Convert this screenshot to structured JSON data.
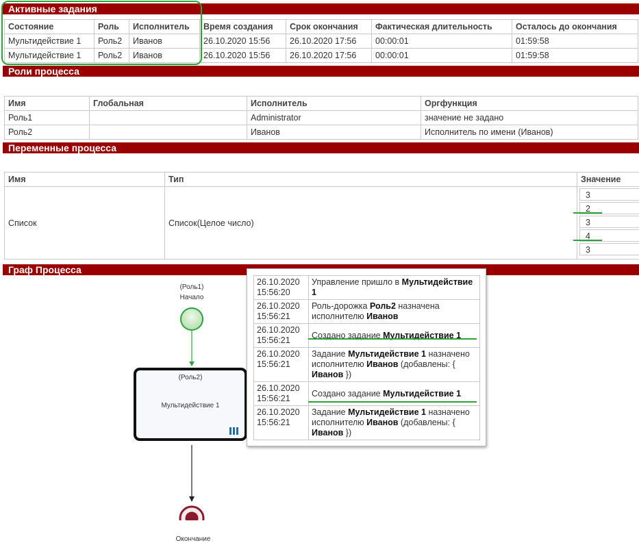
{
  "active_tasks": {
    "title": "Активные задания",
    "columns": [
      "Состояние",
      "Роль",
      "Исполнитель",
      "Время создания",
      "Срок окончания",
      "Фактическая длительность",
      "Осталось до окончания"
    ],
    "rows": [
      [
        "Мультидействие 1",
        "Роль2",
        "Иванов",
        "26.10.2020 15:56",
        "26.10.2020 17:56",
        "00:00:01",
        "01:59:58"
      ],
      [
        "Мультидействие 1",
        "Роль2",
        "Иванов",
        "26.10.2020 15:56",
        "26.10.2020 17:56",
        "00:00:01",
        "01:59:58"
      ]
    ]
  },
  "roles": {
    "title": "Роли процесса",
    "columns": [
      "Имя",
      "Глобальная",
      "Исполнитель",
      "Оргфункция"
    ],
    "rows": [
      [
        "Роль1",
        "",
        "Administrator",
        "значение не задано"
      ],
      [
        "Роль2",
        "",
        "Иванов",
        "Исполнитель по имени (Иванов)"
      ]
    ]
  },
  "variables": {
    "title": "Переменные процесса",
    "columns": [
      "Имя",
      "Тип",
      "Значение"
    ],
    "rows": [
      {
        "name": "Список",
        "type": "Список(Целое число)",
        "values": [
          "3",
          "2",
          "3",
          "4",
          "3"
        ]
      }
    ]
  },
  "graph": {
    "title": "Граф Процесса",
    "start_role": "(Роль1)",
    "start_label": "Начало",
    "task_role": "(Роль2)",
    "task_label": "Мультидействие 1",
    "end_label": "Окончание"
  },
  "history": {
    "rows": [
      {
        "time1": "26.10.2020",
        "time2": "15:56:20",
        "p1": "Управление пришло в ",
        "b1": "Мультидействие 1"
      },
      {
        "time1": "26.10.2020",
        "time2": "15:56:21",
        "p1": "Роль-дорожка ",
        "b1": "Роль2",
        "p2": " назначена исполнителю ",
        "b2": "Иванов"
      },
      {
        "time1": "26.10.2020",
        "time2": "15:56:21",
        "p1": "Создано задание ",
        "b1": "Мультидействие 1"
      },
      {
        "time1": "26.10.2020",
        "time2": "15:56:21",
        "p1": "Задание ",
        "b1": "Мультидействие 1",
        "p2": " назначено исполнителю ",
        "b2": "Иванов",
        "p3": " (добавлены: { ",
        "b3": "Иванов",
        "p4": " })"
      },
      {
        "time1": "26.10.2020",
        "time2": "15:56:21",
        "p1": "Создано задание ",
        "b1": "Мультидействие 1"
      },
      {
        "time1": "26.10.2020",
        "time2": "15:56:21",
        "p1": "Задание ",
        "b1": "Мультидействие 1",
        "p2": " назначено исполнителю ",
        "b2": "Иванов",
        "p3": " (добавлены: { ",
        "b3": "Иванов",
        "p4": " })"
      }
    ]
  },
  "colors": {
    "section_bar": "#9a0000",
    "annotation": "#2aa33a",
    "start_node": "#2aa33a",
    "end_node": "#8b1a2b",
    "multi_marker": "#1f6fa6"
  }
}
